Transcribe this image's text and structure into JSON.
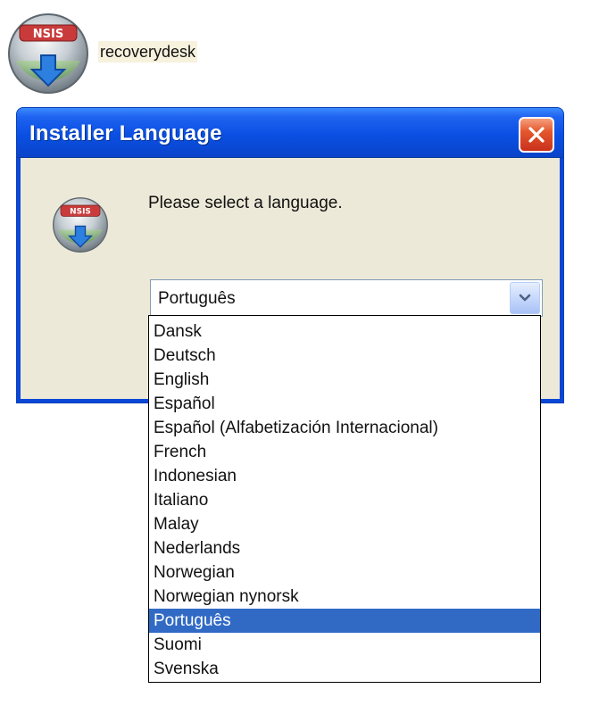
{
  "desktop": {
    "app_label": "recoverydesk",
    "icon": "nsis-installer-icon",
    "icon_badge": "NSIS"
  },
  "dialog": {
    "title": "Installer Language",
    "close_icon": "close-icon",
    "prompt": "Please select a language.",
    "icon": "nsis-installer-icon",
    "icon_badge": "NSIS"
  },
  "language_select": {
    "selected": "Português",
    "arrow_icon": "chevron-down-icon",
    "options": [
      "Dansk",
      "Deutsch",
      "English",
      "Español",
      "Español (Alfabetización Internacional)",
      "French",
      "Indonesian",
      "Italiano",
      "Malay",
      "Nederlands",
      "Norwegian",
      "Norwegian nynorsk",
      "Português",
      "Suomi",
      "Svenska"
    ]
  },
  "colors": {
    "titlebar": "#0a4fe3",
    "client_bg": "#ece9d8",
    "selection_bg": "#316ac5",
    "close_button": "#e4572d"
  }
}
